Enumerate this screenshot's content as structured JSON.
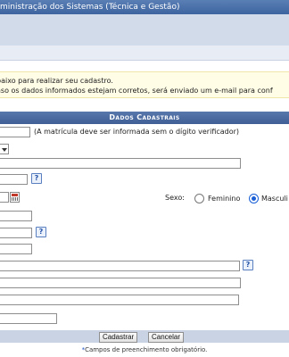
{
  "header": {
    "title": "ministração dos Sistemas (Técnica e Gestão)"
  },
  "notice": {
    "line1": "baixo para realizar seu cadastro.",
    "line2": "aso os dados informados estejam corretos, será enviado um e-mail para conf"
  },
  "form": {
    "section_title": "Dados Cadastrais",
    "matricula_hint": "(A matrícula deve ser informada sem o dígito verificador)",
    "sexo_label": "Sexo:",
    "sexo_options": [
      "Feminino",
      "Masculi"
    ],
    "sexo_selected": "Masculi",
    "help_glyph": "?"
  },
  "buttons": {
    "submit": "Cadastrar",
    "cancel": "Cancelar"
  },
  "footer_note": {
    "star": "*",
    "text": "Campos de preenchimento obrigatório."
  },
  "colors": {
    "header_blue": "#3e64a0",
    "section_blue": "#3f5f96",
    "notice_bg": "#fffde5",
    "radio_blue": "#1a5fd6"
  }
}
